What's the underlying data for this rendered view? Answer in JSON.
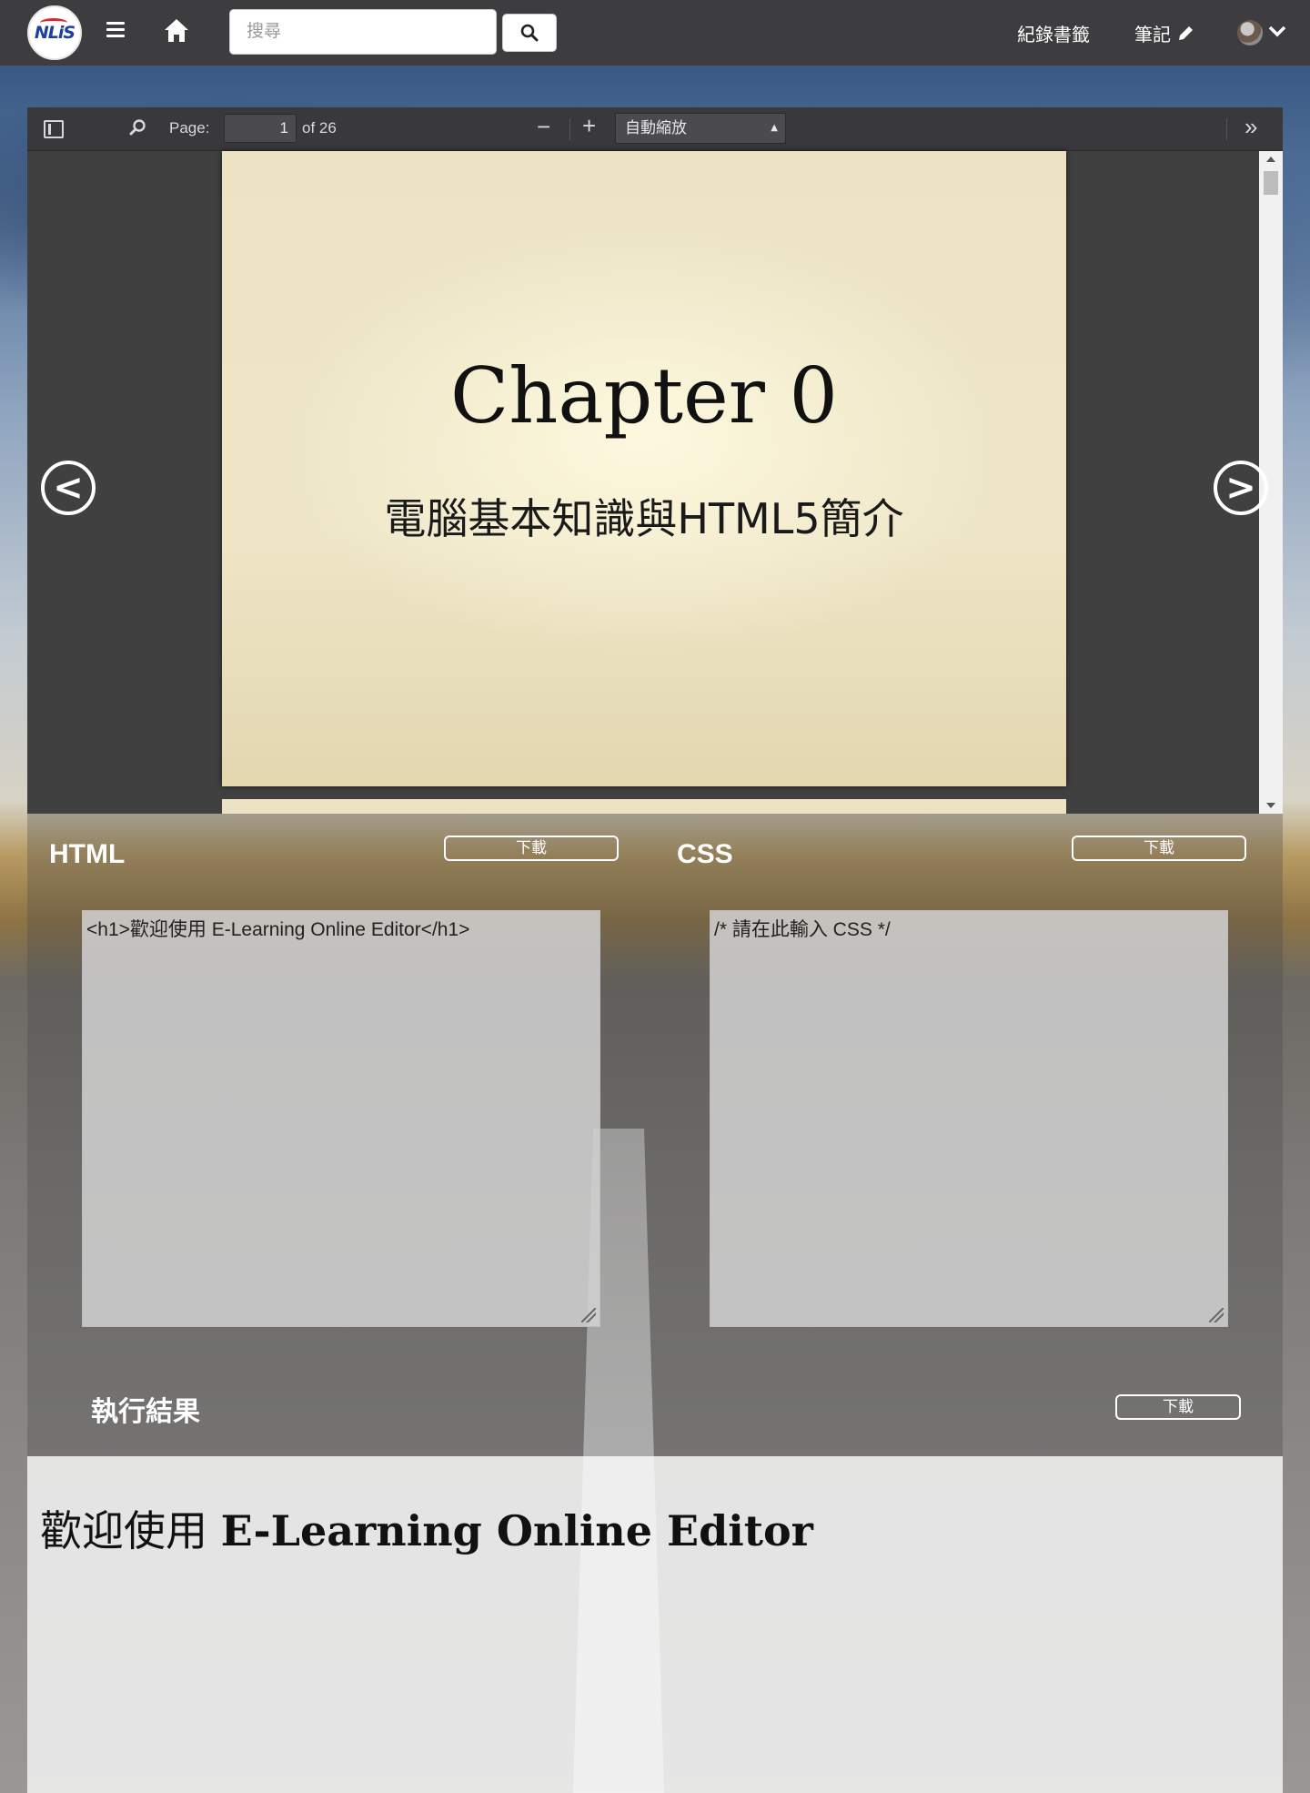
{
  "nav": {
    "logo_text": "NLiS",
    "search_placeholder": "搜尋",
    "bookmark_label": "紀錄書籤",
    "notes_label": "筆記"
  },
  "pdf": {
    "page_label": "Page:",
    "current_page": "1",
    "page_count_text": "of 26",
    "zoom_value": "自動縮放",
    "slide_title": "Chapter 0",
    "slide_subtitle": "電腦基本知識與HTML5簡介",
    "prev_label": "<",
    "next_label": ">"
  },
  "editor": {
    "html_title": "HTML",
    "css_title": "CSS",
    "download_label": "下載",
    "html_code": "<h1>歡迎使用 E-Learning Online Editor</h1>",
    "css_code": "/* 請在此輸入 CSS */",
    "result_title": "執行結果"
  },
  "result": {
    "h1_cjk": "歡迎使用 ",
    "h1_text": "E-Learning Online Editor"
  },
  "icons": {
    "menu": "hamburger-icon",
    "home": "home-icon",
    "search": "search-icon",
    "pencil": "pencil-icon",
    "caret": "chevron-down-icon",
    "sidebar": "sidebar-toggle-icon",
    "find": "search-icon",
    "zoom_out": "minus-icon",
    "zoom_in": "plus-icon",
    "tools": "double-chevron-right-icon"
  }
}
